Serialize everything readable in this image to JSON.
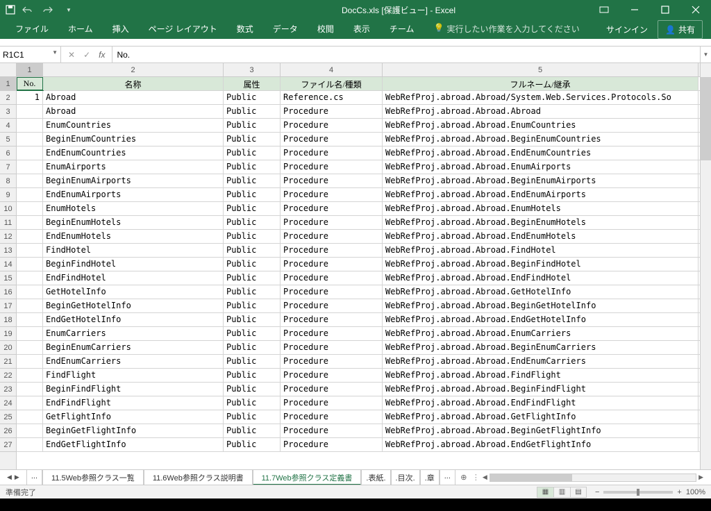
{
  "title": "DocCs.xls [保護ビュー] - Excel",
  "qat": {
    "save": "save-icon",
    "undo": "undo-icon",
    "redo": "redo-icon"
  },
  "ribbon": {
    "tabs": [
      "ファイル",
      "ホーム",
      "挿入",
      "ページ レイアウト",
      "数式",
      "データ",
      "校閲",
      "表示",
      "チーム"
    ],
    "tellme": "実行したい作業を入力してください",
    "signin": "サインイン",
    "share": "共有"
  },
  "nameBox": "R1C1",
  "formula": "No.",
  "cols": [
    "1",
    "2",
    "3",
    "4",
    "5"
  ],
  "header": [
    "No.",
    "名称",
    "属性",
    "ファイル名/種類",
    "フルネーム/継承"
  ],
  "rows": [
    [
      "1",
      "Abroad",
      "Public",
      "Reference.cs",
      "WebRefProj.abroad.Abroad/System.Web.Services.Protocols.So"
    ],
    [
      "",
      "Abroad",
      "Public",
      "Procedure",
      "WebRefProj.abroad.Abroad.Abroad"
    ],
    [
      "",
      "EnumCountries",
      "Public",
      "Procedure",
      "WebRefProj.abroad.Abroad.EnumCountries"
    ],
    [
      "",
      "BeginEnumCountries",
      "Public",
      "Procedure",
      "WebRefProj.abroad.Abroad.BeginEnumCountries"
    ],
    [
      "",
      "EndEnumCountries",
      "Public",
      "Procedure",
      "WebRefProj.abroad.Abroad.EndEnumCountries"
    ],
    [
      "",
      "EnumAirports",
      "Public",
      "Procedure",
      "WebRefProj.abroad.Abroad.EnumAirports"
    ],
    [
      "",
      "BeginEnumAirports",
      "Public",
      "Procedure",
      "WebRefProj.abroad.Abroad.BeginEnumAirports"
    ],
    [
      "",
      "EndEnumAirports",
      "Public",
      "Procedure",
      "WebRefProj.abroad.Abroad.EndEnumAirports"
    ],
    [
      "",
      "EnumHotels",
      "Public",
      "Procedure",
      "WebRefProj.abroad.Abroad.EnumHotels"
    ],
    [
      "",
      "BeginEnumHotels",
      "Public",
      "Procedure",
      "WebRefProj.abroad.Abroad.BeginEnumHotels"
    ],
    [
      "",
      "EndEnumHotels",
      "Public",
      "Procedure",
      "WebRefProj.abroad.Abroad.EndEnumHotels"
    ],
    [
      "",
      "FindHotel",
      "Public",
      "Procedure",
      "WebRefProj.abroad.Abroad.FindHotel"
    ],
    [
      "",
      "BeginFindHotel",
      "Public",
      "Procedure",
      "WebRefProj.abroad.Abroad.BeginFindHotel"
    ],
    [
      "",
      "EndFindHotel",
      "Public",
      "Procedure",
      "WebRefProj.abroad.Abroad.EndFindHotel"
    ],
    [
      "",
      "GetHotelInfo",
      "Public",
      "Procedure",
      "WebRefProj.abroad.Abroad.GetHotelInfo"
    ],
    [
      "",
      "BeginGetHotelInfo",
      "Public",
      "Procedure",
      "WebRefProj.abroad.Abroad.BeginGetHotelInfo"
    ],
    [
      "",
      "EndGetHotelInfo",
      "Public",
      "Procedure",
      "WebRefProj.abroad.Abroad.EndGetHotelInfo"
    ],
    [
      "",
      "EnumCarriers",
      "Public",
      "Procedure",
      "WebRefProj.abroad.Abroad.EnumCarriers"
    ],
    [
      "",
      "BeginEnumCarriers",
      "Public",
      "Procedure",
      "WebRefProj.abroad.Abroad.BeginEnumCarriers"
    ],
    [
      "",
      "EndEnumCarriers",
      "Public",
      "Procedure",
      "WebRefProj.abroad.Abroad.EndEnumCarriers"
    ],
    [
      "",
      "FindFlight",
      "Public",
      "Procedure",
      "WebRefProj.abroad.Abroad.FindFlight"
    ],
    [
      "",
      "BeginFindFlight",
      "Public",
      "Procedure",
      "WebRefProj.abroad.Abroad.BeginFindFlight"
    ],
    [
      "",
      "EndFindFlight",
      "Public",
      "Procedure",
      "WebRefProj.abroad.Abroad.EndFindFlight"
    ],
    [
      "",
      "GetFlightInfo",
      "Public",
      "Procedure",
      "WebRefProj.abroad.Abroad.GetFlightInfo"
    ],
    [
      "",
      "BeginGetFlightInfo",
      "Public",
      "Procedure",
      "WebRefProj.abroad.Abroad.BeginGetFlightInfo"
    ],
    [
      "",
      "EndGetFlightInfo",
      "Public",
      "Procedure",
      "WebRefProj.abroad.Abroad.EndGetFlightInfo"
    ]
  ],
  "sheetTabs": {
    "overflowLeft": "...",
    "items": [
      "11.5Web参照クラス一覧",
      "11.6Web参照クラス説明書",
      "11.7Web参照クラス定義書",
      ".表紙.",
      ".目次.",
      ".章"
    ],
    "activeIndex": 2,
    "overflowRight": "..."
  },
  "status": {
    "ready": "準備完了",
    "zoom": "100%"
  }
}
